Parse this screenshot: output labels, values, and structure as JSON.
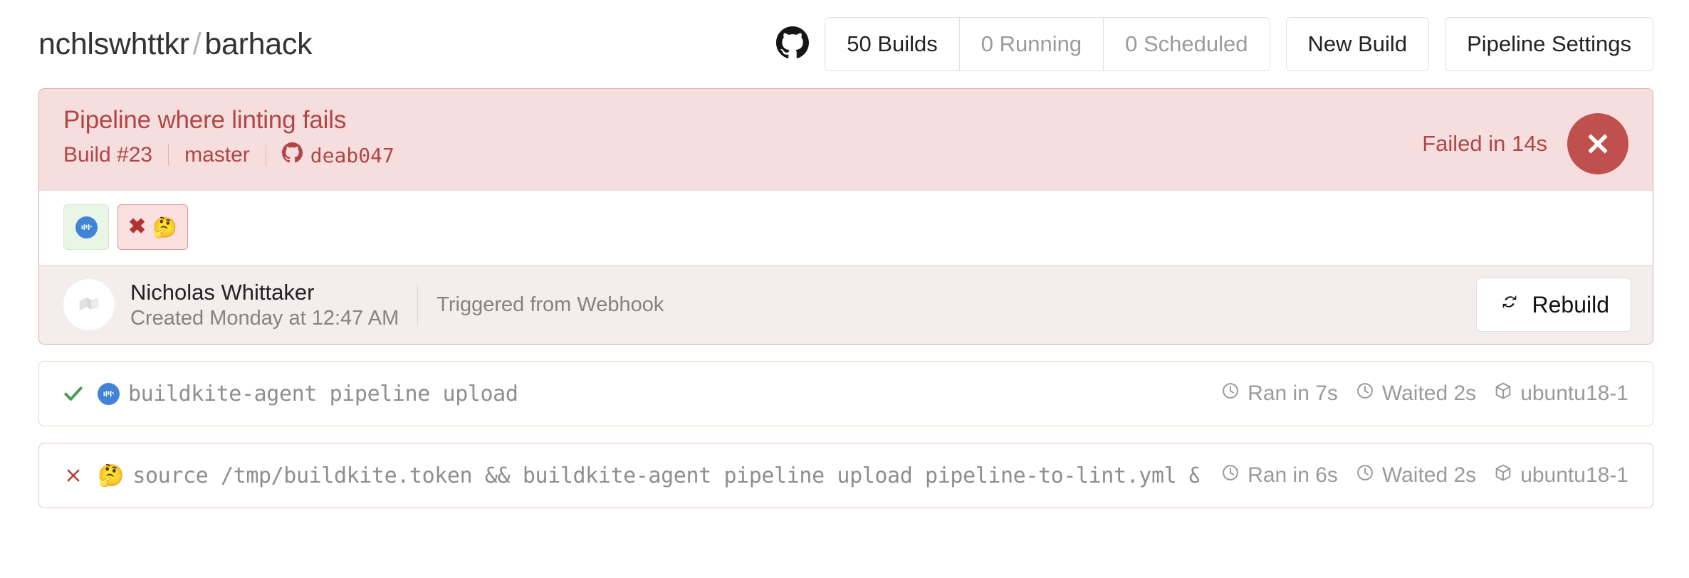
{
  "header": {
    "org": "nchlswhttkr",
    "separator": "/",
    "repo": "barhack",
    "github_icon": "github-mark-icon",
    "segmented": [
      {
        "label": "50 Builds",
        "active": true
      },
      {
        "label": "0 Running",
        "active": false
      },
      {
        "label": "0 Scheduled",
        "active": false
      }
    ],
    "new_build_label": "New Build",
    "pipeline_settings_label": "Pipeline Settings"
  },
  "build": {
    "name": "Pipeline where linting fails",
    "number": "Build #23",
    "branch": "master",
    "commit": "deab047",
    "commit_icon": "github-mark-icon",
    "status_text": "Failed in 14s",
    "status_icon": "x-circle-icon",
    "status_color": "#c0504d",
    "accent_color": "#b24545",
    "head_bg": "#f6dede",
    "steps": [
      {
        "name": "step-badge-passed",
        "state": "pass",
        "emoji": "buildkite-logo-emoji",
        "cross": ""
      },
      {
        "name": "step-badge-failed",
        "state": "fail",
        "emoji": "🤔",
        "cross": "✖"
      }
    ],
    "creator": {
      "avatar_icon": "user-avatar-placeholder-icon",
      "name": "Nicholas Whittaker",
      "created": "Created Monday at 12:47 AM"
    },
    "trigger": "Triggered from Webhook",
    "rebuild_label": "Rebuild",
    "rebuild_icon": "refresh-icon"
  },
  "jobs": [
    {
      "state": "pass",
      "status_icon": "check-icon",
      "emoji": "buildkite-logo-emoji",
      "command": "buildkite-agent pipeline upload",
      "ran": "Ran in 7s",
      "waited": "Waited 2s",
      "agent": "ubuntu18-1",
      "ran_icon": "clock-icon",
      "waited_icon": "clock-icon",
      "agent_icon": "box-icon"
    },
    {
      "state": "fail",
      "status_icon": "x-icon",
      "emoji": "🤔",
      "command": "source /tmp/buildkite.token && buildkite-agent pipeline upload pipeline-to-lint.yml && echo \"PASSED\" …",
      "ran": "Ran in 6s",
      "waited": "Waited 2s",
      "agent": "ubuntu18-1",
      "ran_icon": "clock-icon",
      "waited_icon": "clock-icon",
      "agent_icon": "box-icon"
    }
  ]
}
